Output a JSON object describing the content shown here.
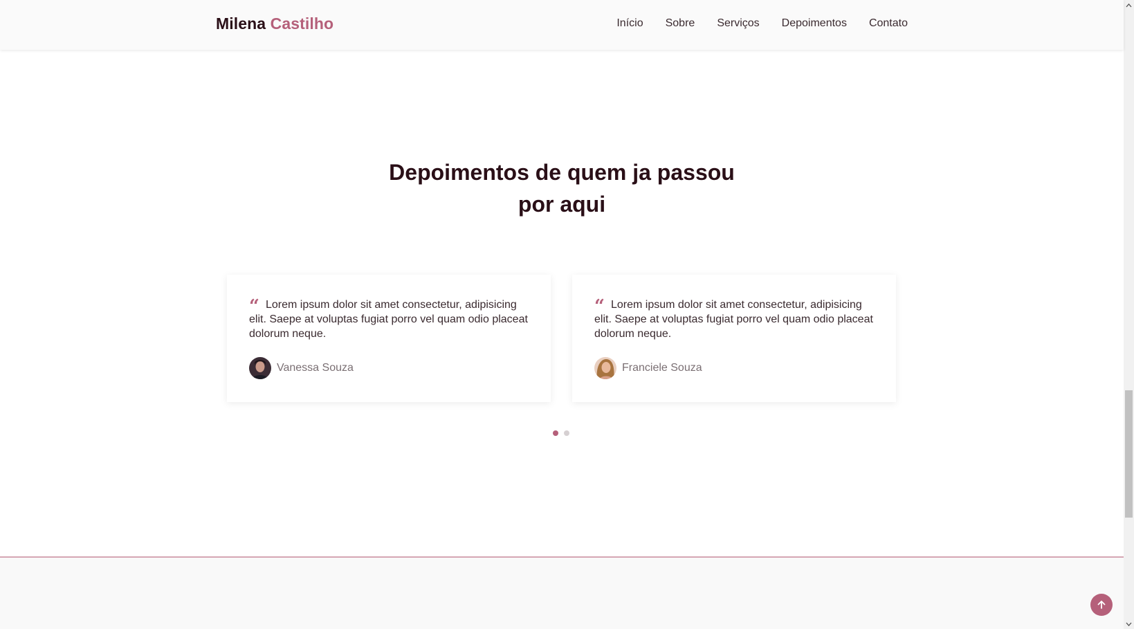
{
  "header": {
    "brand_first": "Milena",
    "brand_second": "Castilho",
    "nav": [
      "Início",
      "Sobre",
      "Serviços",
      "Depoimentos",
      "Contato"
    ]
  },
  "section": {
    "title_line1": "Depoimentos de quem ja passou",
    "title_line2": "por aqui"
  },
  "testimonials": [
    {
      "text": "Lorem ipsum dolor sit amet consectetur, adipisicing elit. Saepe at voluptas fugiat porro vel quam odio placeat dolorum neque.",
      "author": "Vanessa Souza",
      "avatar_icon": "avatar-photo"
    },
    {
      "text": "Lorem ipsum dolor sit amet consectetur, adipisicing elit. Saepe at voluptas fugiat porro vel quam odio placeat dolorum neque.",
      "author": "Franciele Souza",
      "avatar_icon": "avatar-photo"
    }
  ],
  "pagination": {
    "pages": 2,
    "active": 1
  },
  "colors": {
    "accent": "#b5607a",
    "heading": "#2a0f17",
    "footer_border": "#d5a5b3"
  },
  "icons": {
    "quote": "quote-open-icon",
    "back_to_top": "arrow-up-icon"
  }
}
